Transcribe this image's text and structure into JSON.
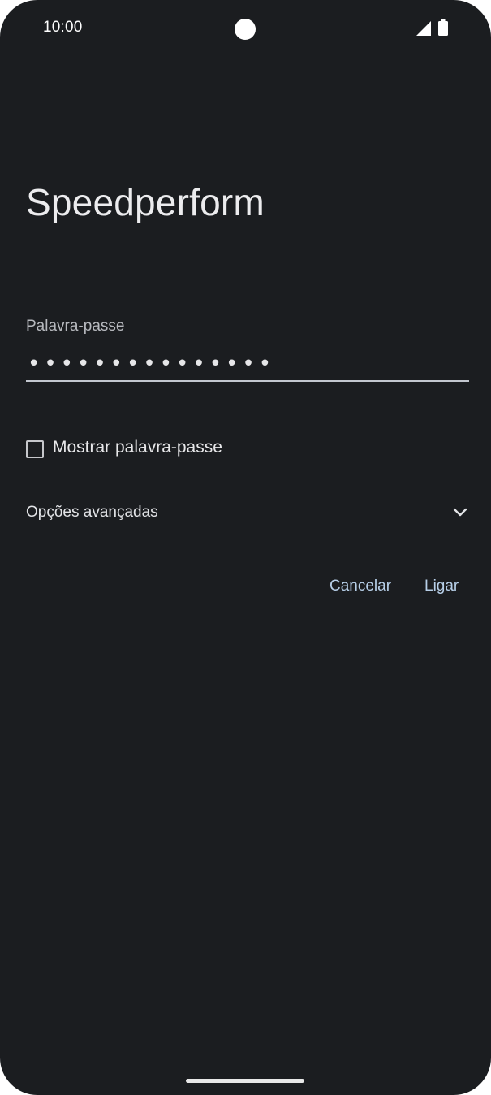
{
  "status_bar": {
    "time": "10:00",
    "icons": [
      "camera-cutout",
      "signal-icon",
      "battery-icon"
    ]
  },
  "dialog": {
    "title": "Speedperform",
    "password_label": "Palavra-passe",
    "password_value": "•••••••••••••••",
    "show_password_label": "Mostrar palavra-passe",
    "show_password_checked": false,
    "advanced_label": "Opções avançadas",
    "cancel_label": "Cancelar",
    "connect_label": "Ligar"
  },
  "colors": {
    "background": "#1b1d20",
    "accent": "#b7cfe8",
    "text": "#e3e3e6"
  }
}
